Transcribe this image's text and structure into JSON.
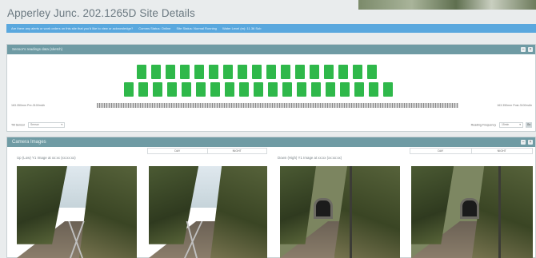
{
  "page": {
    "title": "Apperley Junc. 202.1265D Site Details"
  },
  "alert": {
    "message": "Are there any alerts or work orders on this site that you'd like to view or acknowledge?",
    "comms_status": "Comms Status: Online",
    "site_status": "Site Status: Normal Running",
    "water_level": "Water Level (m): 11.36 Sub"
  },
  "sensors_panel": {
    "title": "Sensor's readings data (sketch)",
    "left_label": "163.350mm Pre-3100mAh",
    "right_label": "163.350mm Post-3100mAh",
    "row1_count": 17,
    "row2_count": 19,
    "tile_color": "#2fb84a",
    "tilt_view_label": "Tilt Sensor",
    "tilt_view_value": "Sensor",
    "reading_freq_label": "Reading Frequency",
    "reading_freq_value": "15min",
    "go_label": "Go"
  },
  "cameras_panel": {
    "title": "Camera Images",
    "left_camera_title": "Up (Low) Y1 Image at xx:xx (xx:xx:xx)",
    "right_camera_title": "Down (High) Y1 Image at xx:xx (xx:xx:xx)",
    "tab_day": "DAY",
    "tab_night": "NIGHT"
  },
  "panel_controls": {
    "minimize": "–",
    "close": "×"
  }
}
